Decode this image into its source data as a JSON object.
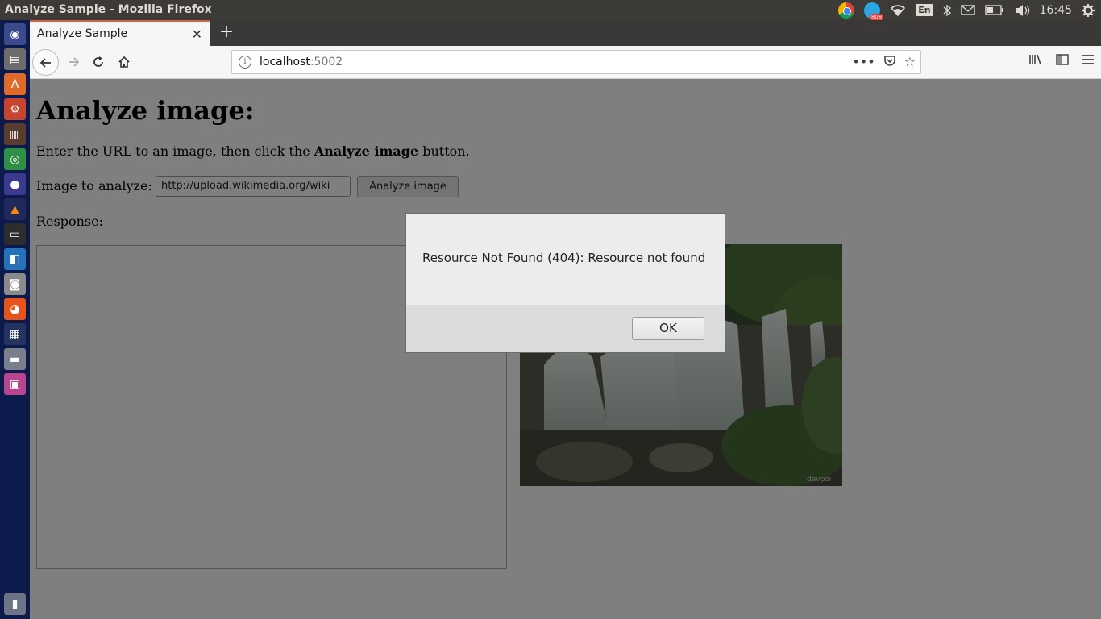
{
  "system": {
    "window_title": "Analyze Sample - Mozilla Firefox",
    "keyboard_layout": "En",
    "telegram_badge": "808",
    "clock": "16:45"
  },
  "launcher": {
    "items": [
      "ubuntu-dash-icon",
      "files-icon",
      "software-center-icon",
      "settings-icon",
      "library-icon",
      "chrome-icon",
      "eclipse-icon",
      "vlc-icon",
      "terminal-icon",
      "code-editor-icon",
      "screenshot-icon",
      "firefox-icon",
      "window-icon",
      "drive-icon",
      "app-icon",
      "trash-icon"
    ]
  },
  "browser": {
    "tab_title": "Analyze Sample",
    "url_host": "localhost",
    "url_port": ":5002"
  },
  "page": {
    "heading": "Analyze image:",
    "intro_prefix": "Enter the URL to an image, then click the ",
    "intro_bold": "Analyze image",
    "intro_suffix": " button.",
    "image_label": "Image to analyze:",
    "image_url_value": "http://upload.wikimedia.org/wiki",
    "analyze_button": "Analyze image",
    "response_label": "Response:",
    "response_text": "",
    "photo_watermark": "devpoi"
  },
  "dialog": {
    "message": "Resource Not Found (404): Resource not found",
    "ok_label": "OK"
  }
}
